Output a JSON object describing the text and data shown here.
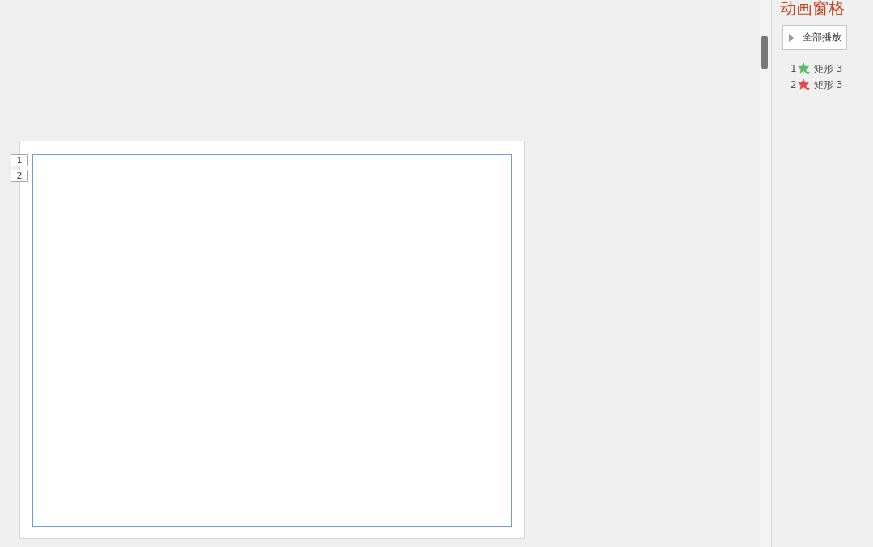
{
  "canvas": {
    "slide_tags": [
      "1",
      "2"
    ]
  },
  "animation_pane": {
    "title": "动画窗格",
    "play_button": {
      "label": "全部播放"
    },
    "items": [
      {
        "number": "1",
        "name": "矩形 3",
        "color": "#5dbb63"
      },
      {
        "number": "2",
        "name": "矩形 3",
        "color": "#e5474c"
      }
    ]
  }
}
